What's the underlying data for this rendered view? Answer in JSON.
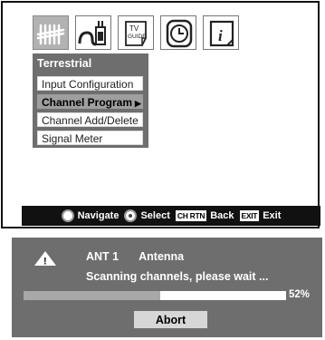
{
  "icons": [
    "antenna-icon",
    "plug-icon",
    "tv-guide-icon",
    "clock-icon",
    "info-icon"
  ],
  "tv_guide_icon_text": {
    "line1": "TV",
    "line2": "GUIDE"
  },
  "info_icon_glyph": "i",
  "submenu": {
    "title": "Terrestrial",
    "items": [
      "Input Configuration",
      "Channel Program",
      "Channel Add/Delete",
      "Signal Meter"
    ],
    "selected_index": 1,
    "selected_arrow": "▶"
  },
  "nav_bar": {
    "navigate_label": "Navigate",
    "select_label": "Select",
    "back_key": "CH RTN",
    "back_label": "Back",
    "exit_key": "EXIT",
    "exit_label": "Exit"
  },
  "scan": {
    "warning_glyph": "!",
    "input": "ANT 1",
    "source": "Antenna",
    "message": "Scanning channels, please wait ...",
    "progress_percent": 52,
    "progress_label": "52%",
    "abort_label": "Abort"
  },
  "colors": {
    "panel_gray": "#6e6e6e",
    "selected_gray": "#9f9f9f",
    "active_icon_gray": "#b2b2b2",
    "progress_fill": "#a8a8a8"
  }
}
